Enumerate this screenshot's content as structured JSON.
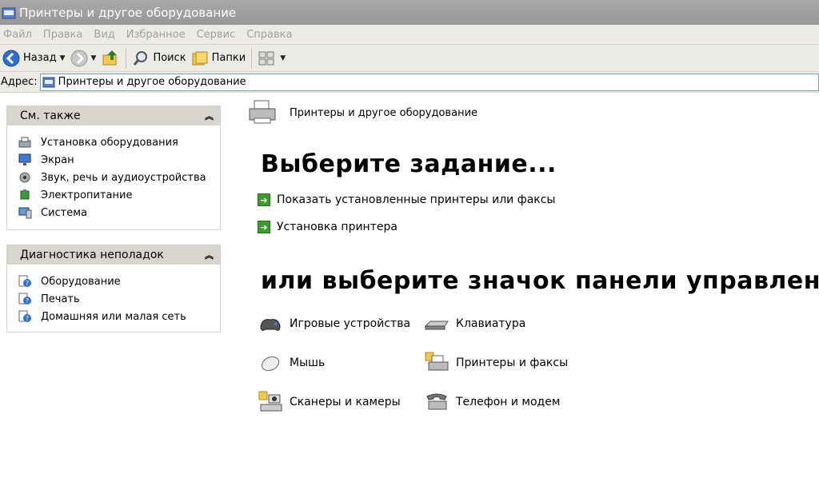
{
  "window": {
    "title": "Принтеры и другое оборудование"
  },
  "menu": [
    "Файл",
    "Правка",
    "Вид",
    "Избранное",
    "Сервис",
    "Справка"
  ],
  "toolbar": {
    "back_label": "Назад",
    "search_label": "Поиск",
    "folders_label": "Папки"
  },
  "address": {
    "label": "Адрес:",
    "value": "Принтеры и другое оборудование"
  },
  "see_also": {
    "title": "См. также",
    "items": [
      {
        "label": "Установка оборудования",
        "icon": "hardware-install-icon"
      },
      {
        "label": "Экран",
        "icon": "display-icon"
      },
      {
        "label": "Звук, речь и аудиоустройства",
        "icon": "sound-icon"
      },
      {
        "label": "Электропитание",
        "icon": "power-icon"
      },
      {
        "label": "Система",
        "icon": "system-icon"
      }
    ]
  },
  "troubleshoot": {
    "title": "Диагностика неполадок",
    "items": [
      {
        "label": "Оборудование",
        "icon": "help-icon"
      },
      {
        "label": "Печать",
        "icon": "help-icon"
      },
      {
        "label": "Домашняя или малая сеть",
        "icon": "help-icon"
      }
    ]
  },
  "main": {
    "header": "Принтеры и другое оборудование",
    "pick_task": "Выберите задание...",
    "tasks": [
      "Показать установленные принтеры или факсы",
      "Установка принтера"
    ],
    "pick_icon": "или выберите значок панели управления",
    "icons": [
      {
        "label": "Игровые устройства",
        "icon": "gamepad-icon"
      },
      {
        "label": "Клавиатура",
        "icon": "keyboard-icon"
      },
      {
        "label": "Мышь",
        "icon": "mouse-icon"
      },
      {
        "label": "Принтеры и факсы",
        "icon": "printer-fax-icon"
      },
      {
        "label": "Сканеры и камеры",
        "icon": "scanner-camera-icon"
      },
      {
        "label": "Телефон и модем",
        "icon": "phone-modem-icon"
      }
    ]
  }
}
